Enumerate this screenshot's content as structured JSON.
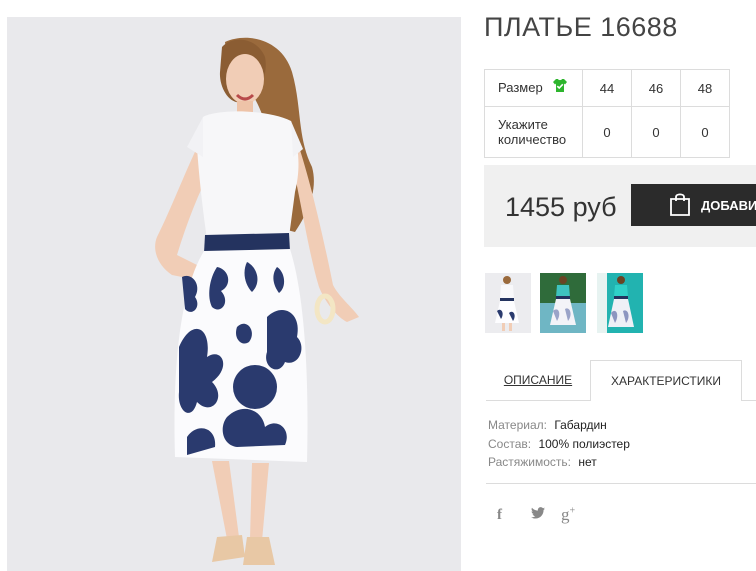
{
  "product": {
    "title": "ПЛАТЬЕ 16688"
  },
  "sizes": {
    "size_label": "Размер",
    "size_icon": "shirt-check-icon",
    "qty_label": "Укажите количество",
    "columns": [
      "44",
      "46",
      "48"
    ],
    "quantities": [
      "0",
      "0",
      "0"
    ]
  },
  "price": {
    "value": "1455 руб",
    "add_label": "ДОБАВИТЬ",
    "add_icon": "shopping-bag-icon"
  },
  "tabs": {
    "description": "ОПИСАНИЕ",
    "characteristics": "ХАРАКТЕРИСТИКИ",
    "active": "characteristics"
  },
  "characteristics": [
    {
      "key": "Материал:",
      "value": "Габардин"
    },
    {
      "key": "Состав:",
      "value": "100% полиэстер"
    },
    {
      "key": "Растяжимость:",
      "value": "нет"
    }
  ],
  "social": {
    "facebook": "f",
    "googleplus": "g",
    "googleplus_sup": "+",
    "icons": [
      "facebook-icon",
      "twitter-icon",
      "google-plus-icon"
    ]
  },
  "colors": {
    "accent_green": "#2db52d",
    "button_dark": "#2b2b2b",
    "price_bg": "#f0f0f0",
    "print_navy": "#2a3a6e",
    "thumb2_bg": "#2f6b3a",
    "thumb3_bg": "#22b3b0"
  }
}
